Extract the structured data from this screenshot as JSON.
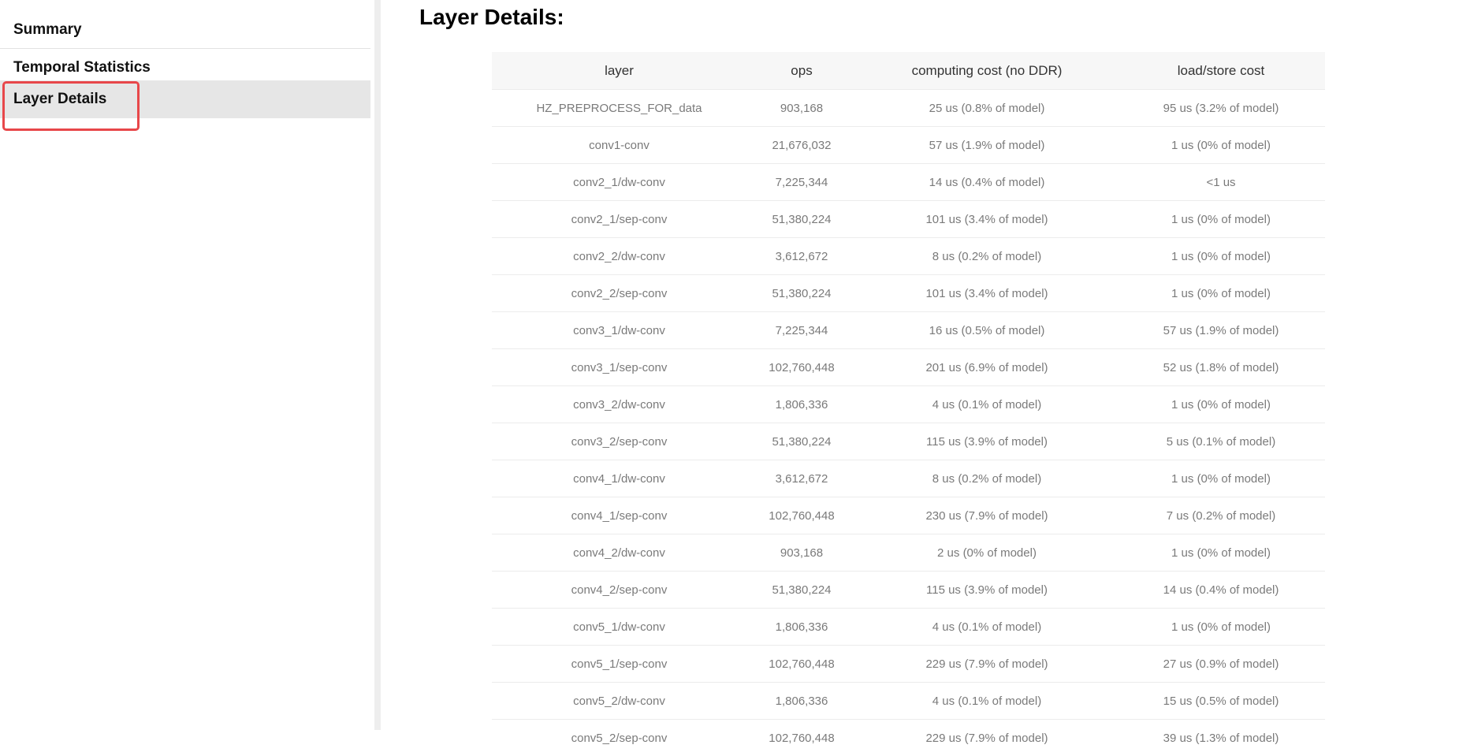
{
  "sidebar": {
    "items": [
      {
        "label": "Summary"
      },
      {
        "label": "Temporal Statistics"
      },
      {
        "label": "Layer Details",
        "selected": true
      }
    ],
    "highlight_color": "#e8474a"
  },
  "main": {
    "title": "Layer Details:",
    "table": {
      "headers": [
        "layer",
        "ops",
        "computing cost (no DDR)",
        "load/store cost"
      ],
      "rows": [
        [
          "HZ_PREPROCESS_FOR_data",
          "903,168",
          "25 us (0.8% of model)",
          "95 us (3.2% of model)"
        ],
        [
          "conv1-conv",
          "21,676,032",
          "57 us (1.9% of model)",
          "1 us (0% of model)"
        ],
        [
          "conv2_1/dw-conv",
          "7,225,344",
          "14 us (0.4% of model)",
          "<1 us"
        ],
        [
          "conv2_1/sep-conv",
          "51,380,224",
          "101 us (3.4% of model)",
          "1 us (0% of model)"
        ],
        [
          "conv2_2/dw-conv",
          "3,612,672",
          "8 us (0.2% of model)",
          "1 us (0% of model)"
        ],
        [
          "conv2_2/sep-conv",
          "51,380,224",
          "101 us (3.4% of model)",
          "1 us (0% of model)"
        ],
        [
          "conv3_1/dw-conv",
          "7,225,344",
          "16 us (0.5% of model)",
          "57 us (1.9% of model)"
        ],
        [
          "conv3_1/sep-conv",
          "102,760,448",
          "201 us (6.9% of model)",
          "52 us (1.8% of model)"
        ],
        [
          "conv3_2/dw-conv",
          "1,806,336",
          "4 us (0.1% of model)",
          "1 us (0% of model)"
        ],
        [
          "conv3_2/sep-conv",
          "51,380,224",
          "115 us (3.9% of model)",
          "5 us (0.1% of model)"
        ],
        [
          "conv4_1/dw-conv",
          "3,612,672",
          "8 us (0.2% of model)",
          "1 us (0% of model)"
        ],
        [
          "conv4_1/sep-conv",
          "102,760,448",
          "230 us (7.9% of model)",
          "7 us (0.2% of model)"
        ],
        [
          "conv4_2/dw-conv",
          "903,168",
          "2 us (0% of model)",
          "1 us (0% of model)"
        ],
        [
          "conv4_2/sep-conv",
          "51,380,224",
          "115 us (3.9% of model)",
          "14 us (0.4% of model)"
        ],
        [
          "conv5_1/dw-conv",
          "1,806,336",
          "4 us (0.1% of model)",
          "1 us (0% of model)"
        ],
        [
          "conv5_1/sep-conv",
          "102,760,448",
          "229 us (7.9% of model)",
          "27 us (0.9% of model)"
        ],
        [
          "conv5_2/dw-conv",
          "1,806,336",
          "4 us (0.1% of model)",
          "15 us (0.5% of model)"
        ],
        [
          "conv5_2/sep-conv",
          "102,760,448",
          "229 us (7.9% of model)",
          "39 us (1.3% of model)"
        ]
      ]
    }
  }
}
